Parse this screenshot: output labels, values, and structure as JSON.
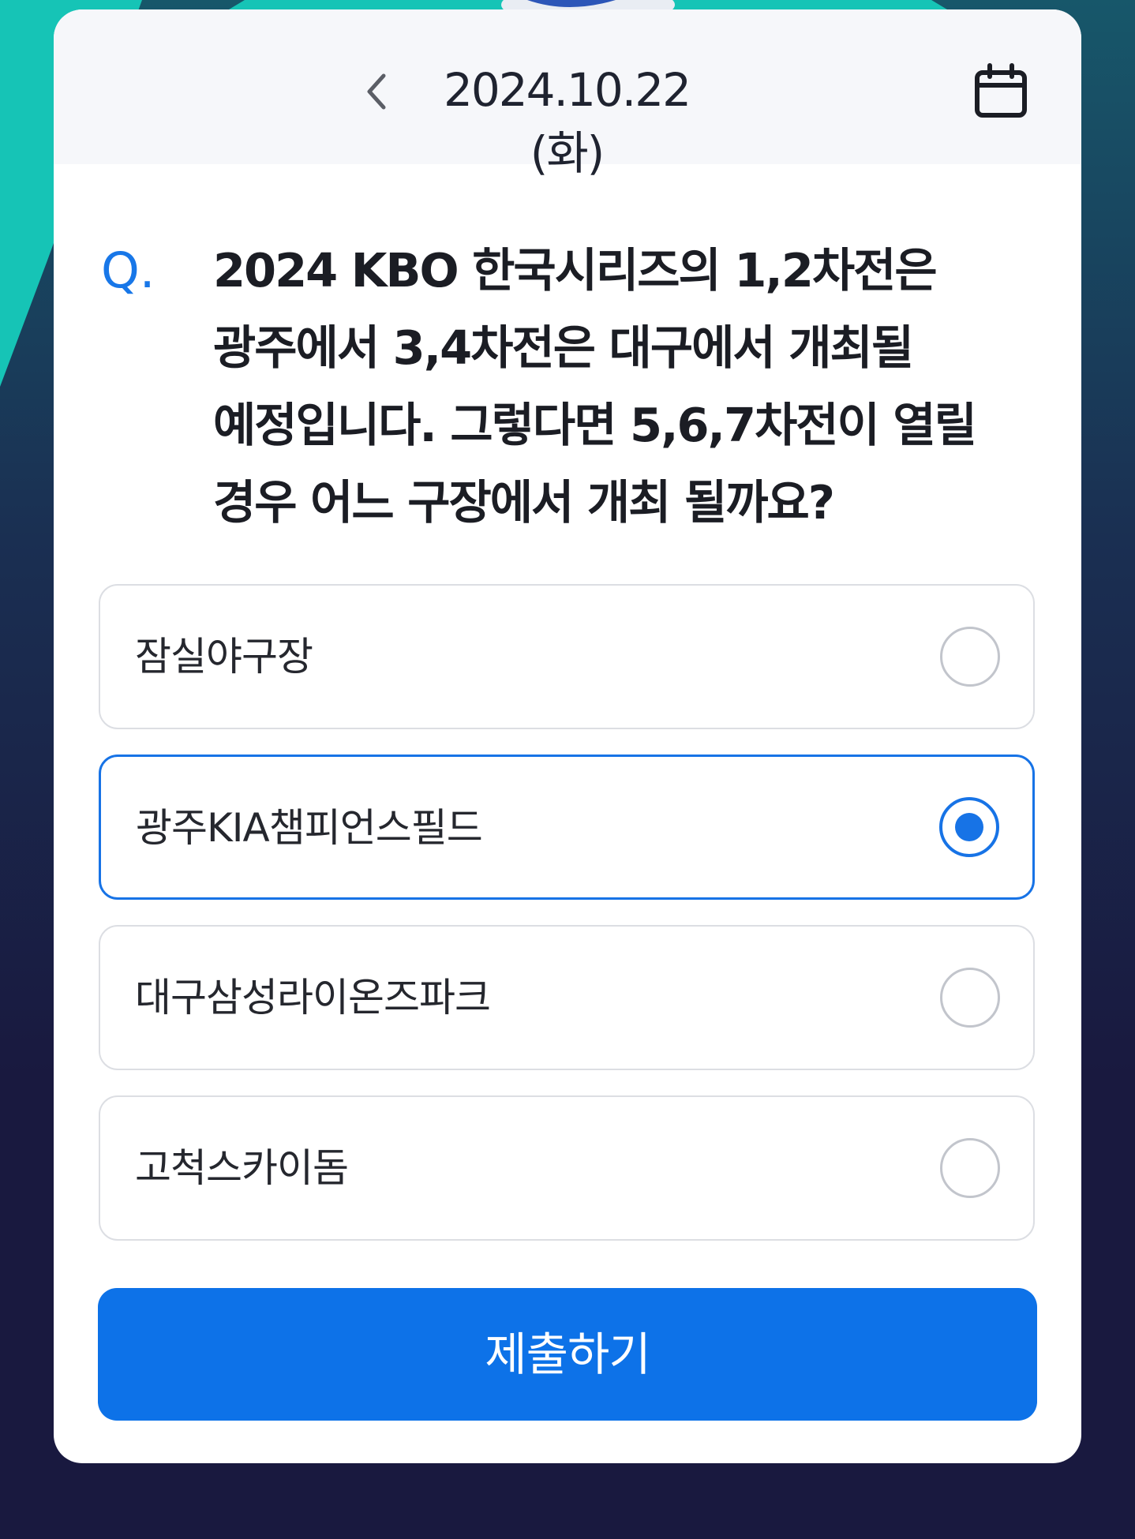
{
  "header": {
    "date": "2024.10.22 (화)",
    "back_icon": "chevron-left-icon",
    "calendar_icon": "calendar-icon"
  },
  "question": {
    "prefix": "Q.",
    "text": "2024 KBO 한국시리즈의 1,2차전은 광주에서 3,4차전은 대구에서 개최될 예정입니다. 그렇다면 5,6,7차전이 열릴 경우 어느 구장에서 개최 될까요?"
  },
  "options": [
    {
      "label": "잠실야구장",
      "selected": false
    },
    {
      "label": "광주KIA챔피언스필드",
      "selected": true
    },
    {
      "label": "대구삼성라이온즈파크",
      "selected": false
    },
    {
      "label": "고척스카이돔",
      "selected": false
    }
  ],
  "submit_label": "제출하기",
  "colors": {
    "accent": "#1773e6",
    "background": "#19193f",
    "teal": "#19c2b8"
  }
}
